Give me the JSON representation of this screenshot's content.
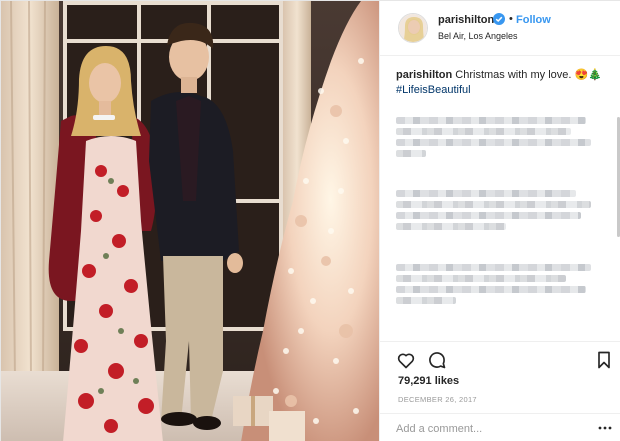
{
  "post": {
    "account": {
      "username": "parishilton",
      "verified": true,
      "follow_label": "Follow",
      "dot": "•",
      "location": "Bel Air, Los Angeles"
    },
    "caption": {
      "username": "parishilton",
      "text": "Christmas with my love. 😍🎄",
      "hashtag": "#LifeisBeautiful"
    },
    "actions": {
      "icons": [
        "heart-icon",
        "comment-icon",
        "bookmark-icon"
      ]
    },
    "likes_label": "79,291 likes",
    "date": "DECEMBER 26, 2017",
    "comment_input": {
      "placeholder": "Add a comment..."
    },
    "colors": {
      "link_blue": "#3897f0",
      "hashtag_blue": "#003569",
      "text": "#262626",
      "muted": "#999999",
      "divider": "#efefef"
    }
  }
}
